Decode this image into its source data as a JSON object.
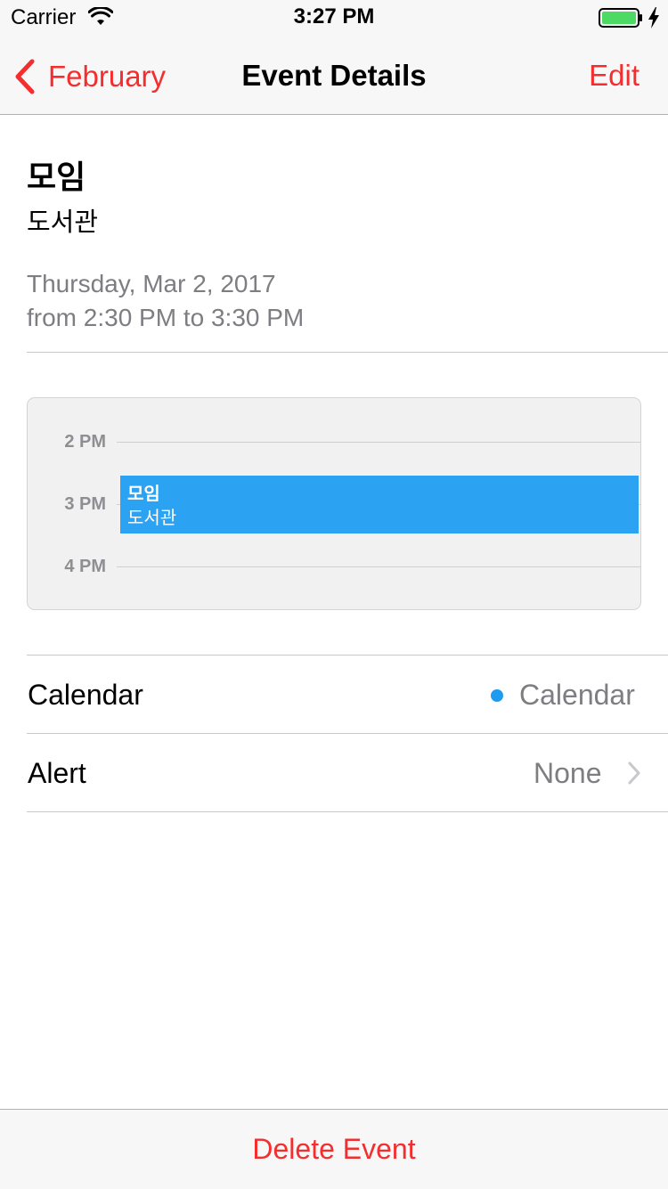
{
  "status_bar": {
    "carrier": "Carrier",
    "time": "3:27 PM",
    "battery_color": "#4cd964"
  },
  "nav": {
    "back_label": "February",
    "title": "Event Details",
    "edit_label": "Edit",
    "accent_color": "#f42e2e"
  },
  "event": {
    "title": "모임",
    "location": "도서관",
    "date": "Thursday, Mar 2, 2017",
    "time": "from 2:30 PM to 3:30 PM"
  },
  "day_preview": {
    "hours": [
      "2 PM",
      "3 PM",
      "4 PM"
    ],
    "event_title": "모임",
    "event_location": "도서관",
    "event_color": "#2ba2f2"
  },
  "rows": {
    "calendar": {
      "label": "Calendar",
      "value": "Calendar",
      "dot_color": "#1d9bf0"
    },
    "alert": {
      "label": "Alert",
      "value": "None"
    }
  },
  "toolbar": {
    "delete_label": "Delete Event"
  }
}
